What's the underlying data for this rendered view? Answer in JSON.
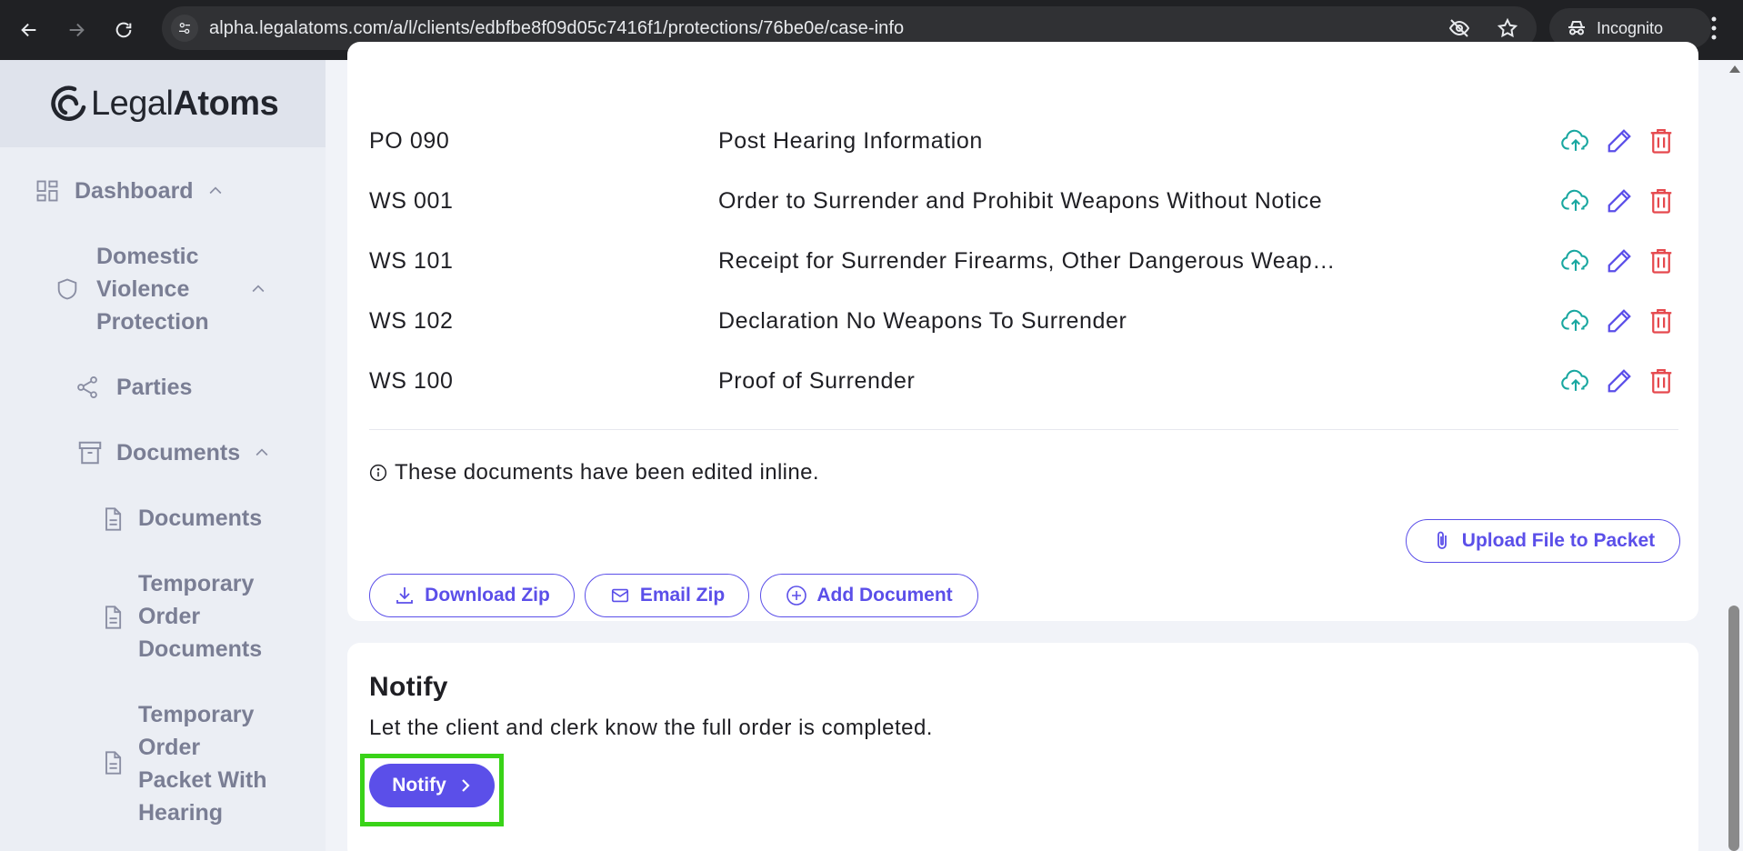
{
  "browser": {
    "url": "alpha.legalatoms.com/a/l/clients/edbfbe8f09d05c7416f1/protections/76be0e/case-info",
    "incognito_label": "Incognito"
  },
  "sidebar": {
    "logo_light": "Legal",
    "logo_bold": "Atoms",
    "dashboard": "Dashboard",
    "dvp_line1": "Domestic",
    "dvp_line2": "Violence",
    "dvp_line3": "Protection",
    "parties": "Parties",
    "documents_group": "Documents",
    "documents_item": "Documents",
    "tod_line1": "Temporary",
    "tod_line2": "Order",
    "tod_line3": "Documents",
    "top_line1": "Temporary",
    "top_line2": "Order",
    "top_line3": "Packet With",
    "top_line4": "Hearing"
  },
  "documents": [
    {
      "code": "PO 090",
      "title": "Post Hearing Information"
    },
    {
      "code": "WS 001",
      "title": "Order to Surrender and Prohibit Weapons Without Notice"
    },
    {
      "code": "WS 101",
      "title": "Receipt for Surrender Firearms, Other Dangerous Weap…"
    },
    {
      "code": "WS 102",
      "title": "Declaration No Weapons To Surrender"
    },
    {
      "code": "WS 100",
      "title": "Proof of Surrender"
    }
  ],
  "info_note": "These documents have been edited inline.",
  "buttons": {
    "upload_packet": "Upload File to Packet",
    "download_zip": "Download Zip",
    "email_zip": "Email Zip",
    "add_document": "Add Document"
  },
  "notify": {
    "title": "Notify",
    "description": "Let the client and clerk know the full order is completed.",
    "button": "Notify"
  },
  "colors": {
    "accent": "#5b4fe9",
    "upload_icon": "#19a7a0",
    "delete_icon": "#e5484d",
    "highlight": "#39d318"
  }
}
